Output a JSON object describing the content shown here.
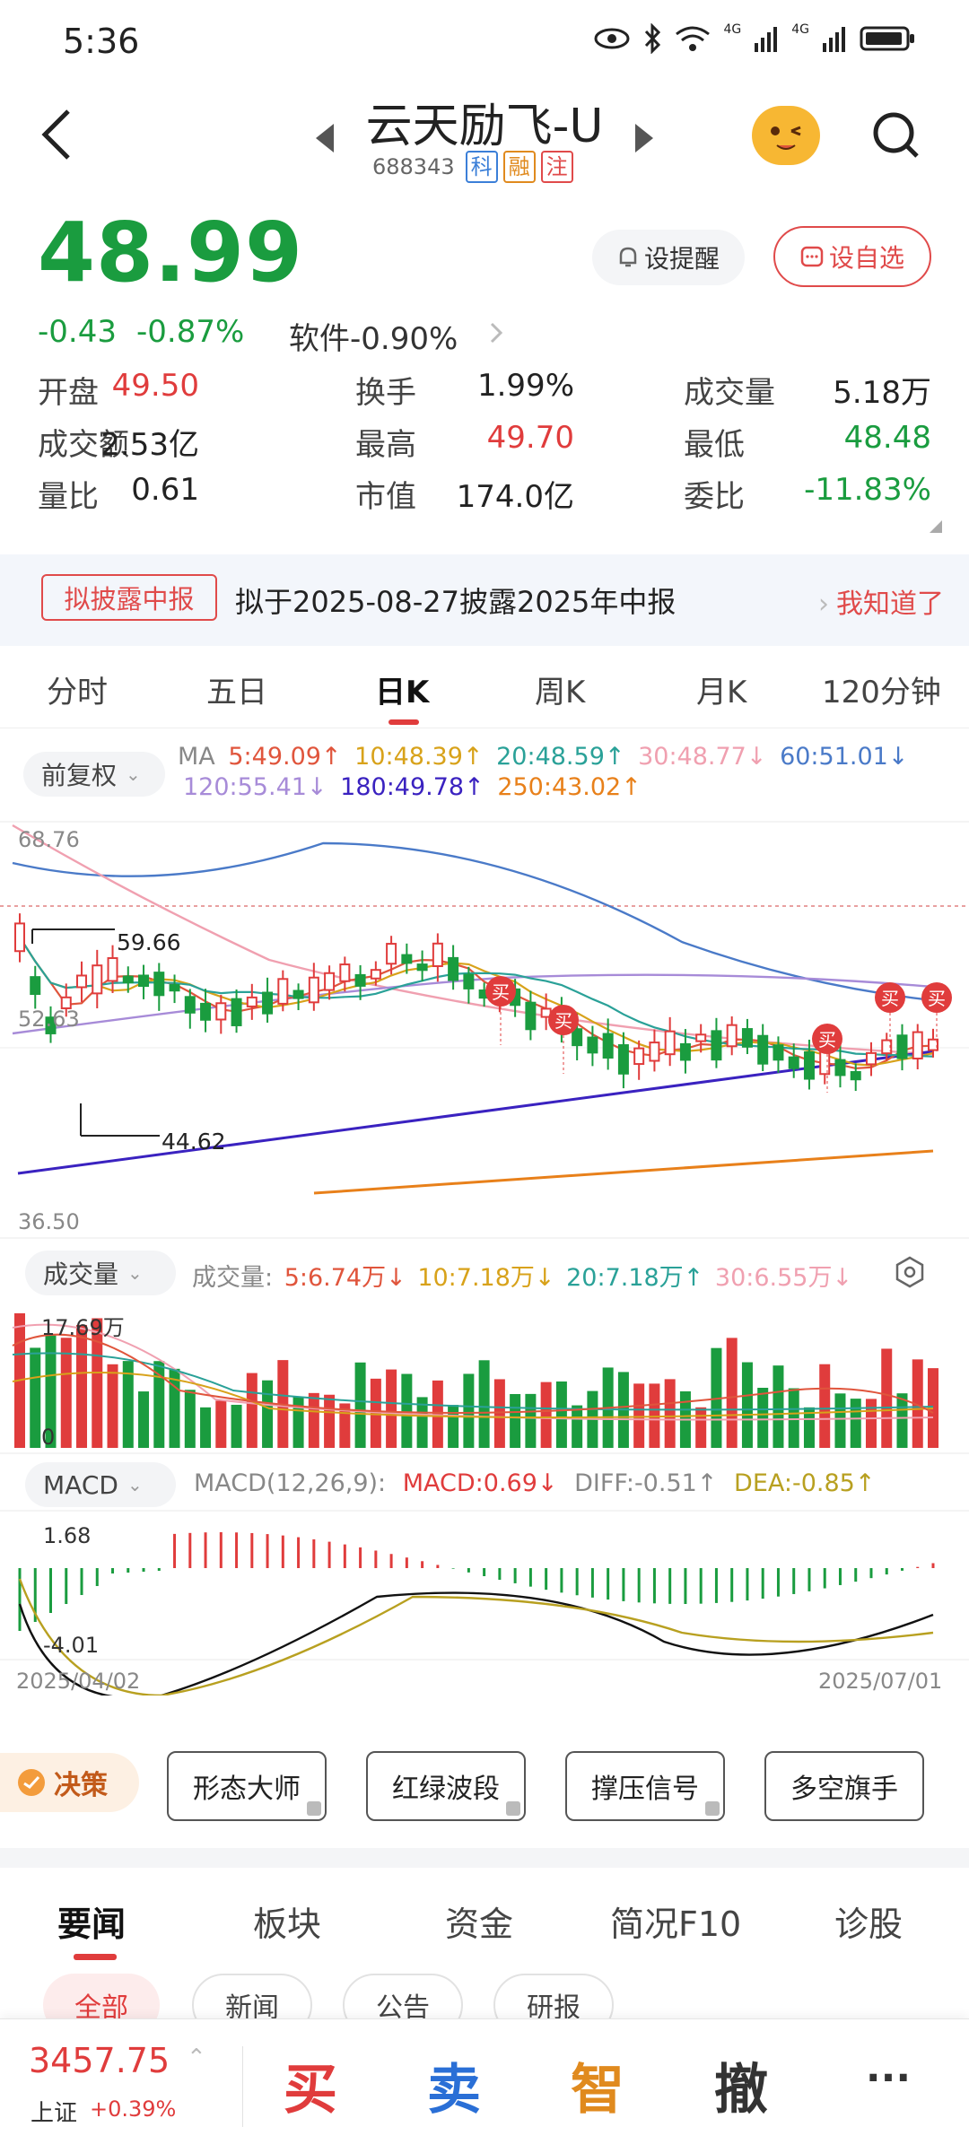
{
  "status_bar": {
    "time": "5:36",
    "icons": [
      "eye-icon",
      "bluetooth-icon",
      "wifi-icon",
      "signal-4g-icon",
      "signal-4g-icon",
      "battery-icon"
    ],
    "net1": "4G",
    "net2": "4G"
  },
  "header": {
    "title": "云天励飞-U",
    "code": "688343",
    "tags": [
      {
        "label": "科",
        "color": "#3b7fd8"
      },
      {
        "label": "融",
        "color": "#e08a1e"
      },
      {
        "label": "注",
        "color": "#e04a4a"
      }
    ]
  },
  "quote": {
    "price": "48.99",
    "change": "-0.43",
    "change_pct": "-0.87%",
    "sector": "软件-0.90%",
    "remind_label": "设提醒",
    "fav_label": "设自选",
    "rows": [
      [
        {
          "k": "开盘",
          "v": "49.50",
          "c": "red"
        },
        {
          "k": "换手",
          "v": "1.99%",
          "c": ""
        },
        {
          "k": "成交量",
          "v": "5.18万",
          "c": ""
        }
      ],
      [
        {
          "k": "成交额",
          "v": "2.53亿",
          "c": ""
        },
        {
          "k": "最高",
          "v": "49.70",
          "c": "red"
        },
        {
          "k": "最低",
          "v": "48.48",
          "c": "green"
        }
      ],
      [
        {
          "k": "量比",
          "v": "0.61",
          "c": ""
        },
        {
          "k": "市值",
          "v": "174.0亿",
          "c": ""
        },
        {
          "k": "委比",
          "v": "-11.83%",
          "c": "green"
        }
      ]
    ]
  },
  "banner": {
    "tag": "拟披露中报",
    "text": "拟于2025-08-27披露2025年中报",
    "link": "我知道了"
  },
  "period_tabs": [
    "分时",
    "五日",
    "日K",
    "周K",
    "月K",
    "120分钟"
  ],
  "active_period": "日K",
  "ma": {
    "adjust_label": "前复权",
    "label": "MA",
    "items": [
      {
        "text": "5:49.09↑",
        "color": "#e0553c"
      },
      {
        "text": "10:48.39↑",
        "color": "#d8a21a"
      },
      {
        "text": "20:48.59↑",
        "color": "#2aa198"
      },
      {
        "text": "30:48.77↓",
        "color": "#f0a0b0"
      },
      {
        "text": "60:51.01↓",
        "color": "#4a7ac8"
      },
      {
        "text": "120:55.41↓",
        "color": "#a78bd8"
      },
      {
        "text": "180:49.78↑",
        "color": "#3a22c0"
      },
      {
        "text": "250:43.02↑",
        "color": "#e8801a"
      }
    ]
  },
  "kline_axis": {
    "top": "68.76",
    "mid": "52.63",
    "bottom": "36.50",
    "high_mark": "59.66",
    "low_mark": "44.62",
    "buy_label": "买"
  },
  "volume": {
    "selector": "成交量",
    "label": "成交量:",
    "items": [
      {
        "text": "5:6.74万↓",
        "color": "#e0553c"
      },
      {
        "text": "10:7.18万↓",
        "color": "#d8a21a"
      },
      {
        "text": "20:7.18万↑",
        "color": "#2aa198"
      },
      {
        "text": "30:6.55万↓",
        "color": "#f0a0b0"
      }
    ],
    "max_label": "17.69万",
    "zero_label": "0"
  },
  "macd": {
    "selector": "MACD",
    "params": "MACD(12,26,9):",
    "items": [
      {
        "text": "MACD:0.69↓",
        "color": "#e03c3c"
      },
      {
        "text": "DIFF:-0.51↑",
        "color": "#888888"
      },
      {
        "text": "DEA:-0.85↑",
        "color": "#b8a020"
      }
    ],
    "top_label": "1.68",
    "bottom_label": "-4.01"
  },
  "date_range": {
    "start": "2025/04/02",
    "end": "2025/07/01"
  },
  "tools": {
    "decide": "决策",
    "buttons": [
      "形态大师",
      "红绿波段",
      "撑压信号",
      "多空旗手"
    ]
  },
  "news_tabs": [
    "要闻",
    "板块",
    "资金",
    "简况F10",
    "诊股"
  ],
  "news_chips": [
    "全部",
    "新闻",
    "公告",
    "研报"
  ],
  "bottom_bar": {
    "index_value": "3457.75",
    "index_name": "上证",
    "index_change": "+0.39%",
    "buy": "买",
    "sell": "卖",
    "smart": "智",
    "cancel": "撤",
    "more": "···"
  }
}
